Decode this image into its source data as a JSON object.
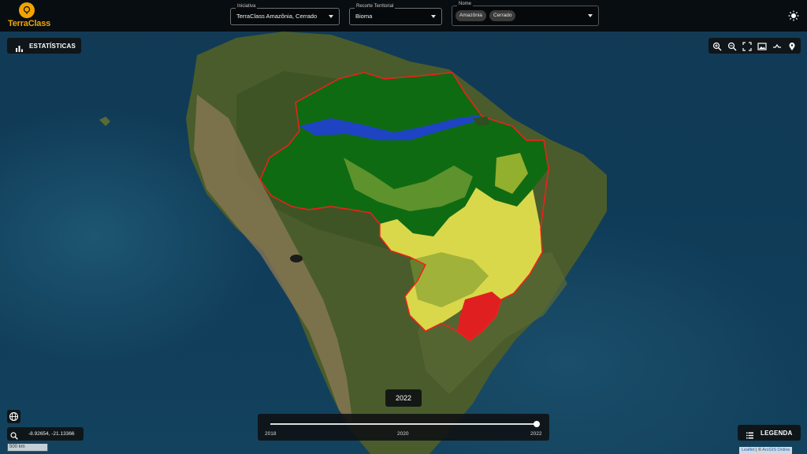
{
  "app": {
    "logo_text_a": "Terra",
    "logo_text_b": "Class"
  },
  "filters": {
    "iniciativa": {
      "label": "Iniciativa",
      "value": "TerraClass Amazônia, Cerrado"
    },
    "recorte": {
      "label": "Recorte Territorial",
      "value": "Bioma"
    },
    "nome": {
      "label": "Nome",
      "chips": [
        "Amazônia",
        "Cerrado"
      ]
    }
  },
  "buttons": {
    "stats": "ESTATÍSTICAS",
    "legend": "LEGENDA"
  },
  "toolbar": {
    "icons": [
      "zoom-in-icon",
      "zoom-out-icon",
      "fullscreen-icon",
      "image-icon",
      "swipe-icon",
      "location-pin-icon"
    ]
  },
  "timeline": {
    "selected_year": "2022",
    "start": "2018",
    "middle": "2020",
    "end": "2022",
    "progress": 1.0
  },
  "coordinates": "-8.92654, -21.13366",
  "scale": "500 km",
  "attribution": {
    "leaflet": "Leaflet",
    "separator": " | © ",
    "source": "ArcGIS Online"
  },
  "colors": {
    "brand_orange": "#f2a300",
    "forest": "#0f6b12",
    "cerrado_yellow": "#e8e84a",
    "boundary_red": "#ff1a1a",
    "water_blue": "#1f3fd6"
  }
}
